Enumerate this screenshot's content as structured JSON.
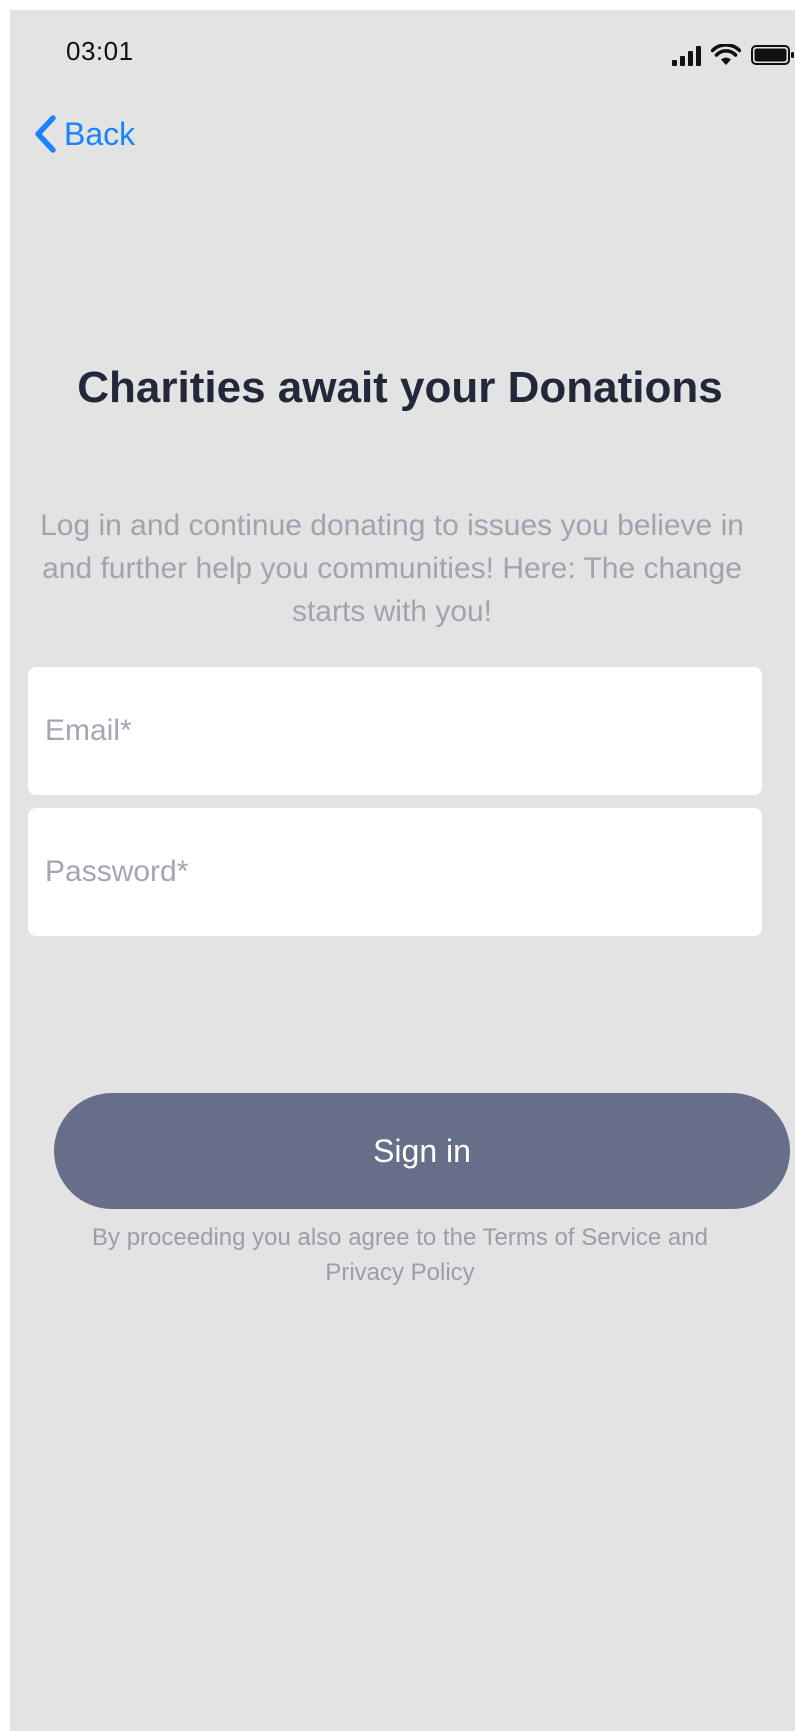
{
  "status_bar": {
    "time": "03:01",
    "signal_icon": "cellular-signal-icon",
    "wifi_icon": "wifi-icon",
    "battery_icon": "battery-icon"
  },
  "nav": {
    "back_label": "Back",
    "back_icon": "chevron-left-icon"
  },
  "header": {
    "title": "Charities await your Donations",
    "subtitle": "Log in and continue donating to issues you believe in and further help you communities! Here: The change starts with you!"
  },
  "form": {
    "email_placeholder": "Email*",
    "email_value": "",
    "password_placeholder": "Password*",
    "password_value": "",
    "signin_label": "Sign in",
    "legal_text": "By proceeding you also agree to the Terms of Service and Privacy Policy"
  },
  "colors": {
    "background": "#e3e3e3",
    "accent": "#1a82fb",
    "button": "#676e89",
    "title": "#22283a",
    "muted": "#a0a4b1"
  }
}
